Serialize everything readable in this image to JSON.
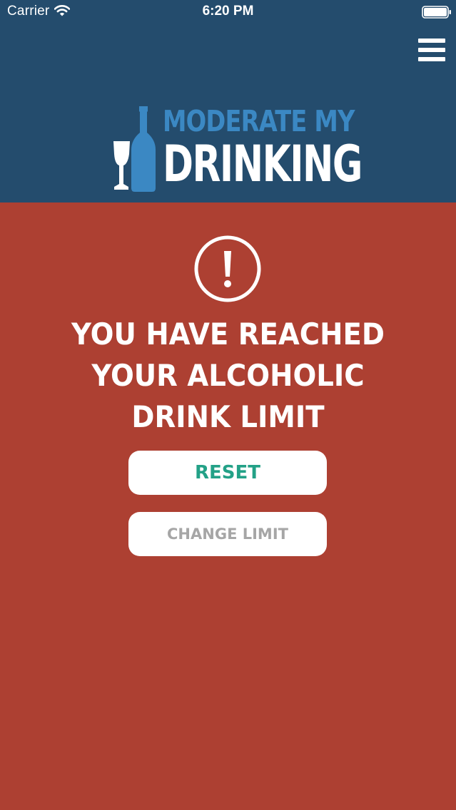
{
  "status_bar": {
    "carrier": "Carrier",
    "time": "6:20 PM",
    "wifi_icon": "wifi-icon",
    "battery_icon": "battery-icon"
  },
  "header": {
    "menu_icon": "hamburger-menu-icon",
    "logo": {
      "line1": "MODERATE MY",
      "line2": "DRINKING",
      "icon": "wine-bottle-and-glass-icon"
    }
  },
  "alert": {
    "icon": "exclamation-circle-icon",
    "heading_lines": [
      "YOU HAVE REACHED",
      "YOUR ALCOHOLIC",
      "DRINK LIMIT"
    ]
  },
  "actions": {
    "reset_label": "RESET",
    "change_limit_label": "CHANGE LIMIT"
  },
  "colors": {
    "header_bg": "#244c6d",
    "alert_bg": "#ad4032",
    "logo_blue": "#3b88c3",
    "reset_text": "#23a187",
    "change_limit_text": "#a6a6a6"
  }
}
